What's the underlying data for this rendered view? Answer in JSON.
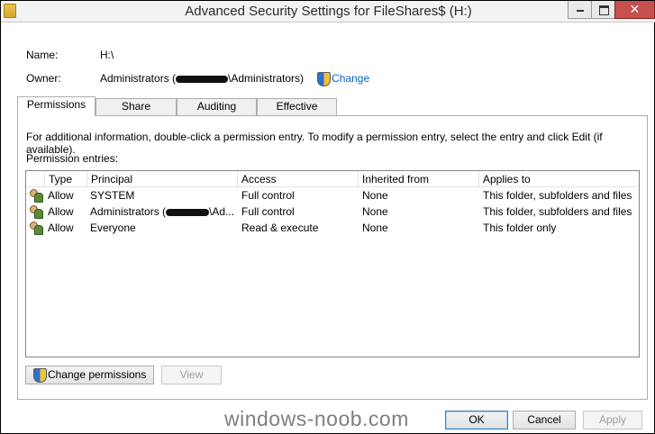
{
  "window": {
    "title": "Advanced Security Settings for FileShares$ (H:)",
    "close_glyph": "✕"
  },
  "fields": {
    "name_label": "Name:",
    "name_value": "H:\\",
    "owner_label": "Owner:",
    "owner_prefix": "Administrators (",
    "owner_suffix": "\\Administrators)",
    "change_link": "Change"
  },
  "tabs": [
    {
      "label": "Permissions",
      "active": true
    },
    {
      "label": "Share",
      "active": false
    },
    {
      "label": "Auditing",
      "active": false
    },
    {
      "label": "Effective Access",
      "active": false
    }
  ],
  "info_text": "For additional information, double-click a permission entry. To modify a permission entry, select the entry and click Edit (if available).",
  "entries_label": "Permission entries:",
  "columns": [
    "Type",
    "Principal",
    "Access",
    "Inherited from",
    "Applies to"
  ],
  "entries": [
    {
      "type": "Allow",
      "principal": "SYSTEM",
      "access": "Full control",
      "inherited": "None",
      "applies": "This folder, subfolders and files"
    },
    {
      "type": "Allow",
      "principal_prefix": "Administrators (",
      "principal_suffix": "\\Ad...",
      "access": "Full control",
      "inherited": "None",
      "applies": "This folder, subfolders and files"
    },
    {
      "type": "Allow",
      "principal": "Everyone",
      "access": "Read & execute",
      "inherited": "None",
      "applies": "This folder only"
    }
  ],
  "buttons": {
    "change_permissions": "Change permissions",
    "view": "View",
    "ok": "OK",
    "cancel": "Cancel",
    "apply": "Apply"
  },
  "watermark": "windows-noob.com",
  "icons": {
    "title": "folder-icon",
    "uac": "uac-shield-icon",
    "entry": "user-group-icon"
  },
  "colors": {
    "link": "#0066cc",
    "close_button": "#c75050"
  }
}
